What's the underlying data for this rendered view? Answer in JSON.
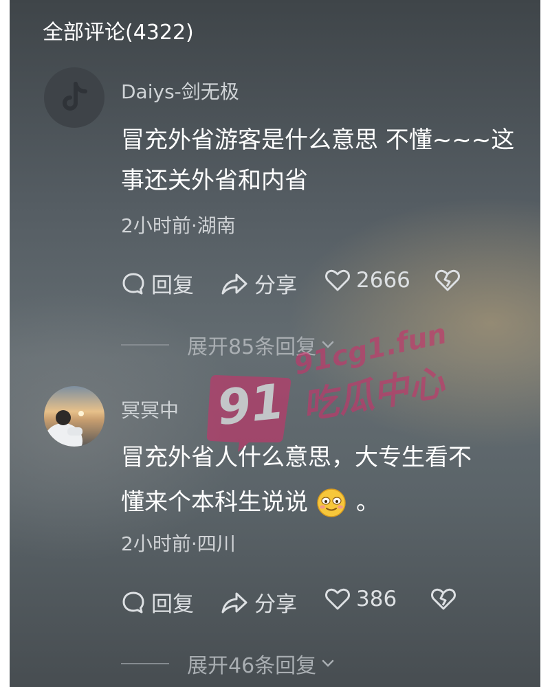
{
  "header": {
    "title": "全部评论(4322)"
  },
  "comments": [
    {
      "username": "Daiys-剑无极",
      "text_line1": "冒充外省游客是什么意思 不懂~~~这",
      "text_line2": "事还关外省和内省",
      "meta": "2小时前·湖南",
      "actions": {
        "reply": "回复",
        "share": "分享",
        "likes": "2666"
      },
      "expand": "展开85条回复"
    },
    {
      "username": "冥冥中",
      "text_line1": "冒充外省人什么意思，大专生看不",
      "text_line2": "懂来个本科生说说",
      "emoji_tail": "。",
      "meta": "2小时前·四川",
      "actions": {
        "reply": "回复",
        "share": "分享",
        "likes": "386"
      },
      "expand": "展开46条回复"
    }
  ],
  "watermark": {
    "number": "91",
    "url": "91cg1.fun",
    "name": "吃瓜中心"
  },
  "colors": {
    "panel_bg": "#5b6469",
    "text_primary": "#ffffff",
    "text_secondary": "#cfd3d6",
    "watermark_pink": "#c8336a"
  },
  "icons": [
    "tiktok-logo-icon",
    "comment-bubble-icon",
    "share-arrow-icon",
    "heart-icon",
    "broken-heart-icon",
    "chevron-down-icon",
    "smiling-face-emoji-icon"
  ]
}
